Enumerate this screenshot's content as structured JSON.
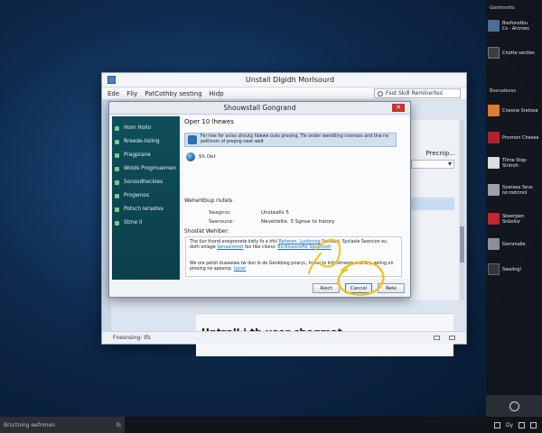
{
  "main_window": {
    "title": "Unstall Dlgidh Morlsourd",
    "menus": [
      "Ede",
      "Fliy",
      "PatCothby sesting",
      "Hidp"
    ],
    "search_placeholder": "Fsst Skdl Remlnertes",
    "right_label": "Precnip...",
    "bottom_heading": "Untrall i tb user chogmat",
    "status_text": "Fnesnsing: tfs"
  },
  "dialog": {
    "title": "Shouwstall Gongrand",
    "close_label": "✕",
    "nav_items": [
      "Hom Hollo",
      "Rreede-lisling",
      "Pragprane",
      "Wolds Progmuemen",
      "Sonsodheckles",
      "Progwnos",
      "Potsch lersetes",
      "Stme ll"
    ],
    "heading": "Oper 10 lhewes",
    "info_text": "Fer hee fer aviso shoutg hbewe oute proving, Tle onder wendiling cnerrass and thw ne poltlnom of prepng neet welt",
    "globe_label": "Sh Oet",
    "section1": "Wehehtbup riutels",
    "kv1_key": "Seagnoc",
    "kv1_val": "Unstealls 5",
    "kv2_key": "Seersune:",
    "kv2_val": "Nevetielte. 3 Sgnse to hstory",
    "section2": "Shostet Wehlber:",
    "para1_a": "The tiur thond enegronete kstly fo a hfcl",
    "para1_link1": "Reheren. Lusfoning",
    "para1_b": "Sansunt, Syclasle Searcion eu doth onlage",
    "para1_link2": "Senaaremet",
    "para1_c": "fos tike cliono:",
    "para1_link3": "Borbloasnefte Sponstiotr",
    "para2_a": "We ore pelsit dusawwa tw dun lo de Genkbiog pnaryc, Instal to Infaolmsore and dry. aeling on prosing ne apesnip.",
    "para2_link": "Upsst",
    "btn_back": "Alect",
    "btn_cancel": "Cancel",
    "btn_next": "Rele"
  },
  "notification_panel": {
    "header_top": "Gomtnorts",
    "notif1_title": "Bsofonstbu",
    "notif1_sub": "Cs · Arcrnes",
    "notif2": "Cnotte secties",
    "header_mid": "Bsenaleoss",
    "items": [
      "Cneone Sretose",
      "Pnnmon Cheese",
      "Tllme Stsp · Slntroh",
      "Sywisea Sevs lsr.rodcmnl",
      "Skeergwn Snbolisr",
      "Gemmalle",
      "Swelingl"
    ]
  },
  "taskbar": {
    "search_text": "Brsctning eefnmen",
    "search_suffix": "lS",
    "tray_label": "Dy"
  },
  "colors": {
    "desktop_bg": "#0e2a4d",
    "dialog_sidebar": "#0f4f5a",
    "nav_bullet": "#6fcf8a",
    "link": "#1f6fc0",
    "close_button": "#c8332c",
    "annotation": "#f2c21a"
  },
  "icons": {
    "app_icon": "window-app-icon",
    "info_icon": "info-icon",
    "globe_icon": "globe-icon",
    "search_icon": "search-icon"
  }
}
